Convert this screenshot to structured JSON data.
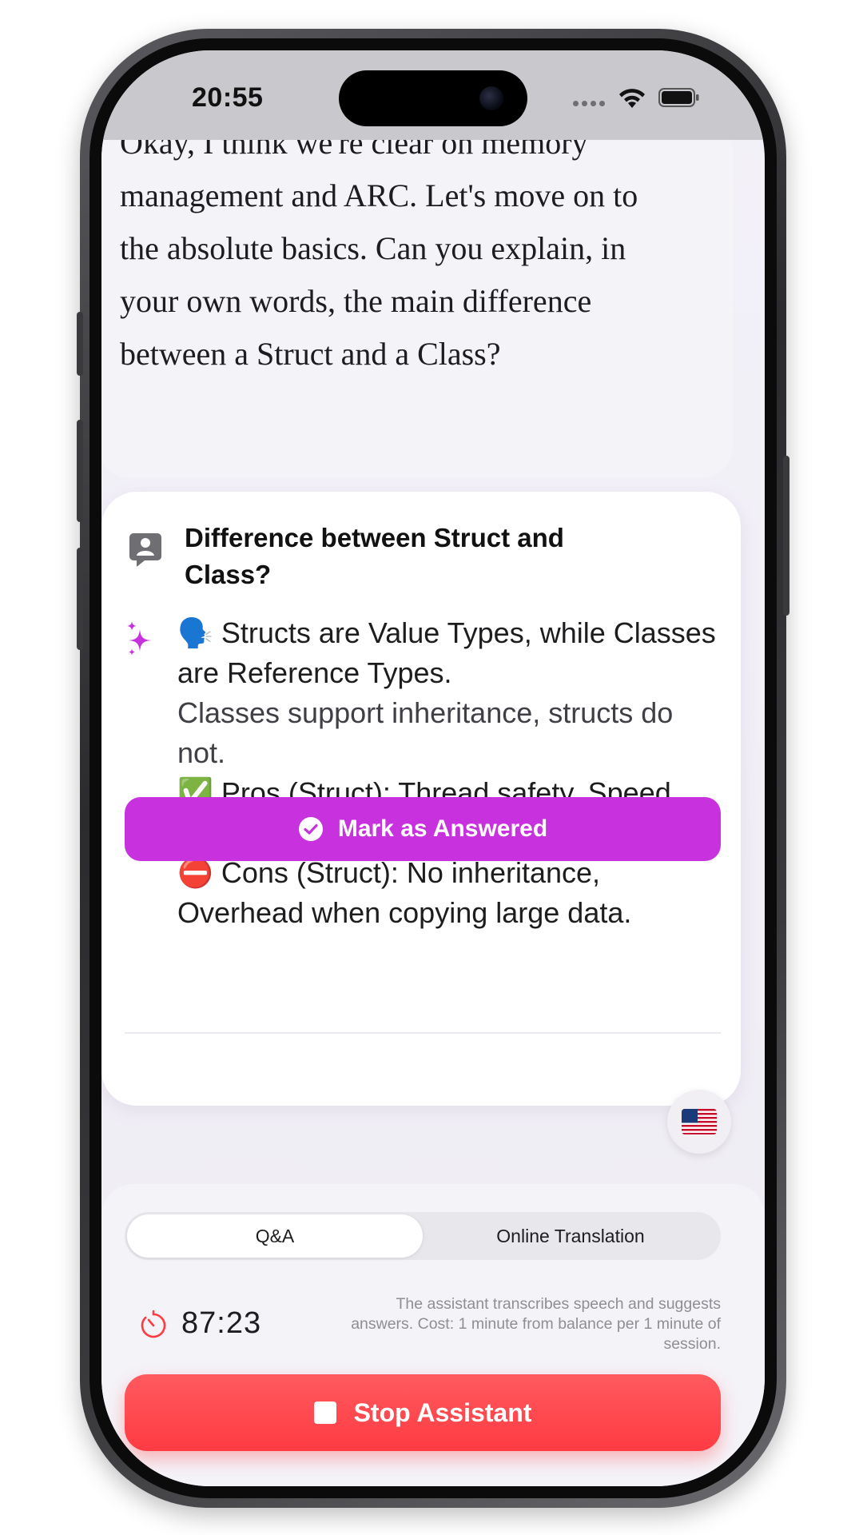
{
  "status_bar": {
    "time": "20:55"
  },
  "transcript": {
    "text": "Okay, I think we're clear on memory management and ARC. Let's move on to the absolute basics. Can you explain, in your own words, the main difference between a Struct and a Class?"
  },
  "answer_card": {
    "question": "Difference between Struct and Class?",
    "answer_lines": [
      "🗣️ Structs are Value Types, while Classes are Reference Types.",
      "Classes support inheritance, structs do not.",
      "✅ Pros (Struct): Thread safety, Speed (Stack allocation), No shared references.",
      "⛔ Cons (Struct): No inheritance, Overhead when copying large data."
    ],
    "mark_button_label": "Mark as Answered"
  },
  "language_flag": "🇺🇸",
  "bottom_panel": {
    "tabs": [
      {
        "label": "Q&A",
        "active": true
      },
      {
        "label": "Online Translation",
        "active": false
      }
    ],
    "timer": "87:23",
    "info": "The assistant transcribes speech and suggests answers. Cost: 1 minute from balance per 1 minute of session.",
    "stop_button_label": "Stop Assistant"
  },
  "colors": {
    "accent_purple": "#c832de",
    "stop_red": "#ff3b42",
    "timer_red": "#ff3b42"
  },
  "icons": [
    "signal-dots-icon",
    "wifi-icon",
    "battery-icon",
    "question-person-icon",
    "sparkle-icon",
    "check-circle-icon",
    "us-flag-icon",
    "timer-icon",
    "stop-square-icon"
  ]
}
